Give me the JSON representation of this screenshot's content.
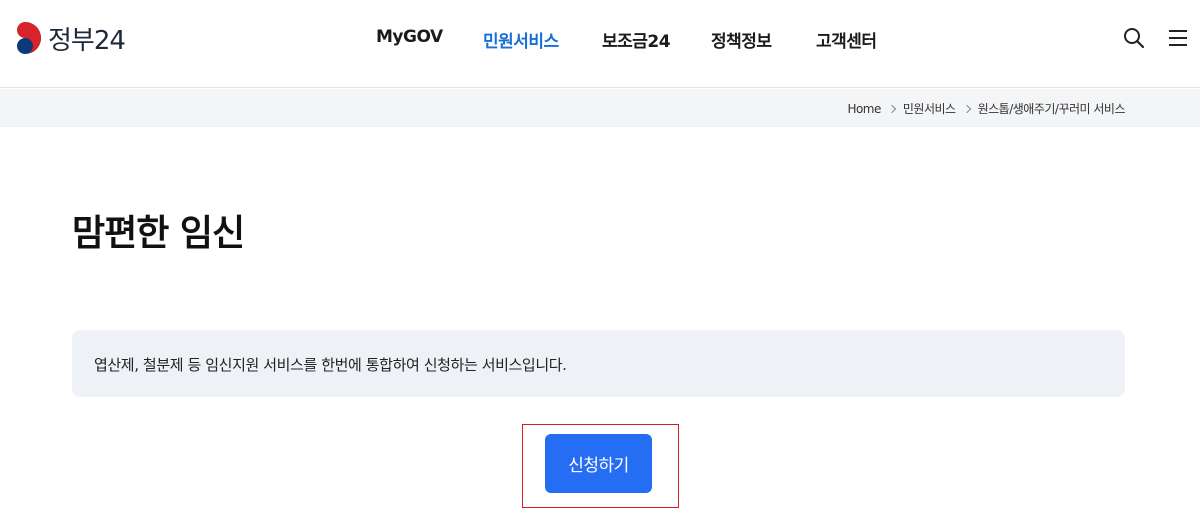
{
  "header": {
    "logo_text": "정부24",
    "nav": [
      {
        "label": "MyGOV",
        "active": false
      },
      {
        "label": "민원서비스",
        "active": true
      },
      {
        "label": "보조금24",
        "active": false
      },
      {
        "label": "정책정보",
        "active": false
      },
      {
        "label": "고객센터",
        "active": false
      }
    ],
    "search_icon": "search-icon",
    "menu_icon": "hamburger-menu-icon"
  },
  "breadcrumb": [
    "Home",
    "민원서비스",
    "원스톱/생애주기/꾸러미 서비스"
  ],
  "page": {
    "title": "맘편한 임신",
    "description": "엽산제, 철분제 등 임신지원 서비스를 한번에 통합하여 신청하는 서비스입니다.",
    "apply_label": "신청하기"
  },
  "colors": {
    "accent": "#256ef4",
    "nav_active": "#1a6fd6",
    "desc_bg": "#eef1f6",
    "highlight": "#d61e1e"
  }
}
